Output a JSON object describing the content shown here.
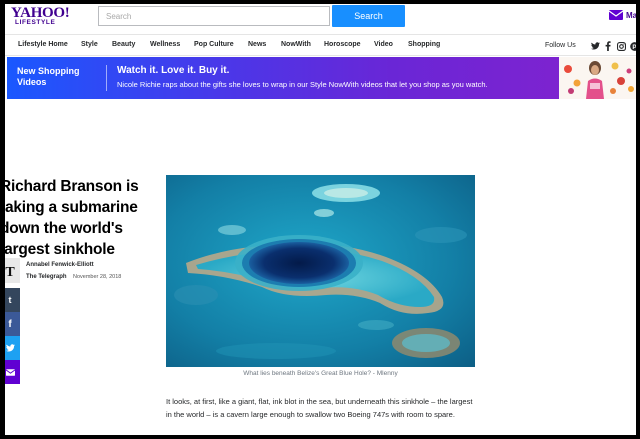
{
  "header": {
    "logo_main": "YAHOO!",
    "logo_sub": "LIFESTYLE",
    "search_placeholder": "Search",
    "search_button": "Search",
    "mail_label": "Ma",
    "mail_icon": "envelope-icon"
  },
  "nav": {
    "items": [
      "Lifestyle Home",
      "Style",
      "Beauty",
      "Wellness",
      "Pop Culture",
      "News",
      "NowWith",
      "Horoscope",
      "Video",
      "Shopping"
    ],
    "follow_label": "Follow Us",
    "social_icons": [
      "twitter-icon",
      "facebook-icon",
      "instagram-icon",
      "pinterest-icon"
    ]
  },
  "promo": {
    "label": "New Shopping Videos",
    "headline": "Watch it. Love it. Buy it.",
    "description": "Nicole Richie raps about the gifts she loves to wrap in our Style NowWith videos that let you shop as you watch."
  },
  "article": {
    "headline": "Richard Branson is taking a submarine down the world's largest sinkhole",
    "author": "Annabel Fenwick-Elliott",
    "source": "The Telegraph",
    "date": "November 28, 2018",
    "caption": "What lies beneath Belize's Great Blue Hole? - Mlenny",
    "body": "It looks, at first, like a giant, flat, ink blot in the sea, but underneath this sinkhole – the largest in the world – is a cavern large enough to swallow two Boeing 747s with room to spare."
  },
  "share": {
    "icons": [
      "tumblr-icon",
      "facebook-icon",
      "twitter-icon",
      "mail-icon"
    ]
  },
  "colors": {
    "brand_purple": "#400090",
    "search_blue": "#188fff",
    "promo_gradient_start": "#1a58ff",
    "promo_gradient_end": "#7d23d0"
  }
}
